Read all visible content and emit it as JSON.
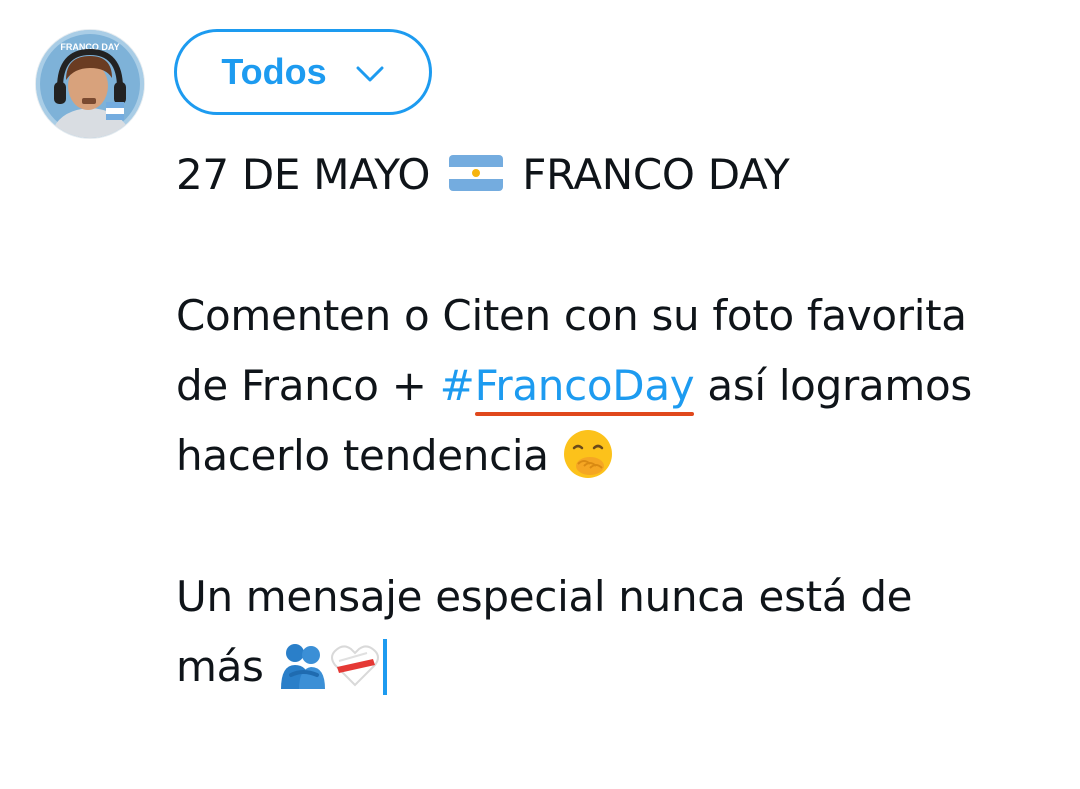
{
  "composer": {
    "audience_label": "Todos",
    "avatar_text": "FRANCO DAY",
    "lines": {
      "l1_before": "27 DE MAYO",
      "l1_after": "FRANCO DAY",
      "l2": "Comenten o Citen con su foto favorita",
      "l3_before": "de Franco + ",
      "hashtag_symbol": "#",
      "hashtag_word": "FrancoDay",
      "l3_after": " así logramos",
      "l4": "hacerlo tendencia ",
      "l5": "Un mensaje especial nunca está de",
      "l6": "más "
    }
  },
  "colors": {
    "accent": "#1d9bf0",
    "spellcheck_underline": "#e0481c",
    "text": "#0f1419",
    "background": "#ffffff"
  },
  "icons": {
    "audience_chevron": "chevron-down-icon",
    "flag": "argentina-flag-icon",
    "emoji_1": "face-with-hand-over-mouth-icon",
    "emoji_2": "people-hugging-icon",
    "emoji_3": "white-heart-bandaged-icon"
  }
}
